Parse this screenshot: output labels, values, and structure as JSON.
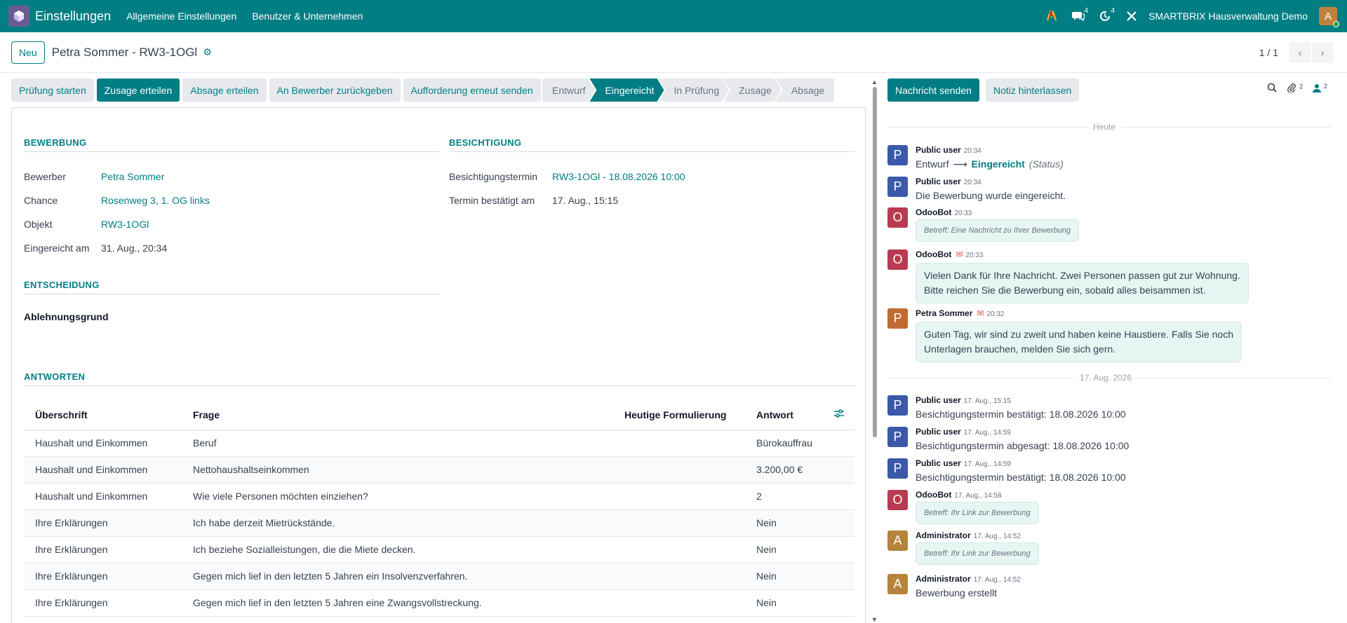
{
  "navbar": {
    "brand": "Einstellungen",
    "menu": [
      "Allgemeine Einstellungen",
      "Benutzer & Unternehmen"
    ],
    "messages_count": "4",
    "activities_count": "4",
    "company": "SMARTBRIX Hausverwaltung Demo",
    "avatar_letter": "A"
  },
  "control": {
    "new_label": "Neu",
    "record_title": "Petra Sommer - RW3-1OGl",
    "pager": "1 / 1"
  },
  "actions": [
    "Prüfung starten",
    "Zusage erteilen",
    "Absage erteilen",
    "An Bewerber zurückgeben",
    "Aufforderung erneut senden"
  ],
  "stages": [
    "Entwurf",
    "Eingereicht",
    "In Prüfung",
    "Zusage",
    "Absage"
  ],
  "form": {
    "section_application": "BEWERBUNG",
    "section_viewing": "BESICHTIGUNG",
    "section_decision": "ENTSCHEIDUNG",
    "section_answers": "ANTWORTEN",
    "applicant_label": "Bewerber",
    "applicant_value": "Petra Sommer",
    "chance_label": "Chance",
    "chance_value": "Rosenweg 3, 1. OG links",
    "object_label": "Objekt",
    "object_value": "RW3-1OGl",
    "submitted_label": "Eingereicht am",
    "submitted_value": "31. Aug., 20:34",
    "viewing_label": "Besichtigungstermin",
    "viewing_value": "RW3-1OGl - 18.08.2026 10:00",
    "confirmed_label": "Termin bestätigt am",
    "confirmed_value": "17. Aug., 15:15",
    "rejection_label": "Ablehnungsgrund"
  },
  "answers": {
    "headers": [
      "Überschrift",
      "Frage",
      "Heutige Formulierung",
      "Antwort"
    ],
    "rows": [
      [
        "Haushalt und Einkommen",
        "Beruf",
        "",
        "Bürokauffrau"
      ],
      [
        "Haushalt und Einkommen",
        "Nettohaushaltseinkommen",
        "",
        "3.200,00 €"
      ],
      [
        "Haushalt und Einkommen",
        "Wie viele Personen möchten einziehen?",
        "",
        "2"
      ],
      [
        "Ihre Erklärungen",
        "Ich habe derzeit Mietrückstände.",
        "",
        "Nein"
      ],
      [
        "Ihre Erklärungen",
        "Ich beziehe Sozialleistungen, die die Miete decken.",
        "",
        "Nein"
      ],
      [
        "Ihre Erklärungen",
        "Gegen mich lief in den letzten 5 Jahren ein Insolvenzverfahren.",
        "",
        "Nein"
      ],
      [
        "Ihre Erklärungen",
        "Gegen mich lief in den letzten 5 Jahren eine Zwangsvollstreckung.",
        "",
        "Nein"
      ]
    ]
  },
  "chatter": {
    "send_label": "Nachricht senden",
    "note_label": "Notiz hinterlassen",
    "attachments_count": "2",
    "followers_count": "2",
    "sep_today": "Heute",
    "sep_date": "17. Aug. 2026",
    "messages": [
      {
        "author": "Public user",
        "time": "20:34",
        "avatar": "P",
        "from": "Entwurf",
        "to": "Eingereicht",
        "tag": "(Status)"
      },
      {
        "author": "Public user",
        "time": "20:34",
        "avatar": "P",
        "body": "Die Bewerbung wurde eingereicht."
      },
      {
        "author": "OdooBot",
        "time": "20:33",
        "avatar": "O",
        "body": "Betreff: Eine Nachricht zu Ihrer Bewerbung"
      },
      {
        "author": "OdooBot",
        "time": "20:33",
        "avatar": "O",
        "line1": "Vielen Dank für Ihre Nachricht. Zwei Personen passen gut zur Wohnung.",
        "line2": "Bitte reichen Sie die Bewerbung ein, sobald alles beisammen ist."
      },
      {
        "author": "Petra Sommer",
        "time": "20:32",
        "avatar": "P",
        "line1": "Guten Tag, wir sind zu zweit und haben keine Haustiere. Falls Sie noch",
        "line2": "Unterlagen brauchen, melden Sie sich gern."
      },
      {
        "author": "Public user",
        "time": "17. Aug., 15:15",
        "avatar": "P",
        "body": "Besichtigungstermin bestätigt: 18.08.2026 10:00"
      },
      {
        "author": "Public user",
        "time": "17. Aug., 14:59",
        "avatar": "P",
        "body": "Besichtigungstermin abgesagt: 18.08.2026 10:00"
      },
      {
        "author": "Public user",
        "time": "17. Aug., 14:59",
        "avatar": "P",
        "body": "Besichtigungstermin bestätigt: 18.08.2026 10:00"
      },
      {
        "author": "OdooBot",
        "time": "17. Aug., 14:58",
        "avatar": "O",
        "body": "Betreff: Ihr Link zur Bewerbung"
      },
      {
        "author": "Administrator",
        "time": "17. Aug., 14:52",
        "avatar": "A",
        "body": "Betreff: Ihr Link zur Bewerbung"
      },
      {
        "author": "Administrator",
        "time": "17. Aug., 14:52",
        "avatar": "A",
        "body": "Bewerbung erstellt"
      }
    ]
  }
}
